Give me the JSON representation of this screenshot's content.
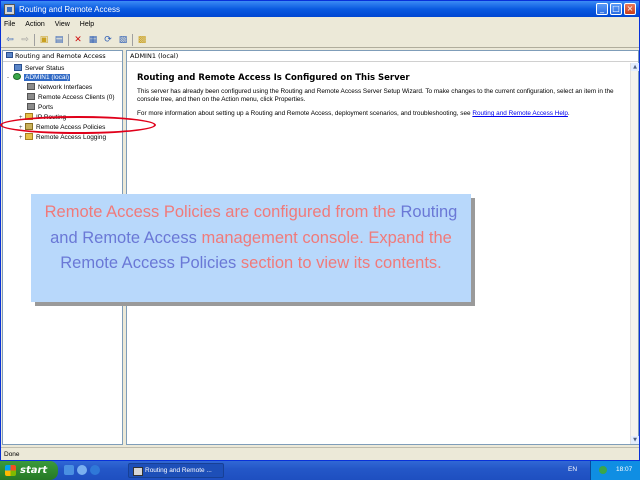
{
  "window": {
    "title": "Routing and Remote Access",
    "controls": {
      "minimize": "_",
      "maximize": "□",
      "close": "×"
    }
  },
  "menu": [
    "File",
    "Action",
    "View",
    "Help"
  ],
  "toolbar": {
    "icons": [
      "back-icon",
      "forward-icon",
      "up-folder-icon",
      "show-hide-tree-icon",
      "delete-icon",
      "properties-icon",
      "refresh-icon",
      "export-icon",
      "help-icon"
    ]
  },
  "tree": {
    "header": "Routing and Remote Access",
    "items": [
      {
        "label": "Server Status",
        "expander": ""
      },
      {
        "label": "ADMIN1 (local)",
        "expander": "-"
      },
      {
        "label": "Network Interfaces",
        "expander": ""
      },
      {
        "label": "Remote Access Clients (0)",
        "expander": ""
      },
      {
        "label": "Ports",
        "expander": ""
      },
      {
        "label": "IP Routing",
        "expander": "+"
      },
      {
        "label": "Remote Access Policies",
        "expander": "+"
      },
      {
        "label": "Remote Access Logging",
        "expander": "+"
      }
    ]
  },
  "content": {
    "header": "ADMIN1 (local)",
    "heading": "Routing and Remote Access Is Configured on This Server",
    "paragraph1": "This server has already been configured using the Routing and Remote Access Server Setup Wizard. To make changes to the current configuration, select an item in the console tree, and then on the Action menu, click Properties.",
    "paragraph2_prefix": "For more information about setting up a Routing and Remote Access, deployment scenarios, and troubleshooting, see ",
    "paragraph2_link": "Routing and Remote Access Help",
    "paragraph2_suffix": "."
  },
  "statusbar": {
    "text": "Done"
  },
  "callout": {
    "part1": "Remote Access Policies are configured from the ",
    "part2": "Routing and Remote Access",
    "part3": " management console. Expand the ",
    "part4": "Remote Access Policies",
    "part5": " section to view its contents."
  },
  "taskbar": {
    "start_label": "start",
    "task_label": "Routing and Remote ...",
    "language": "EN",
    "clock": "18:07"
  },
  "colors": {
    "highlight_circle": "#e0001a",
    "callout_bg": "#b8d8fb",
    "callout_red": "#f07a7a",
    "callout_blue": "#6a78d6"
  }
}
